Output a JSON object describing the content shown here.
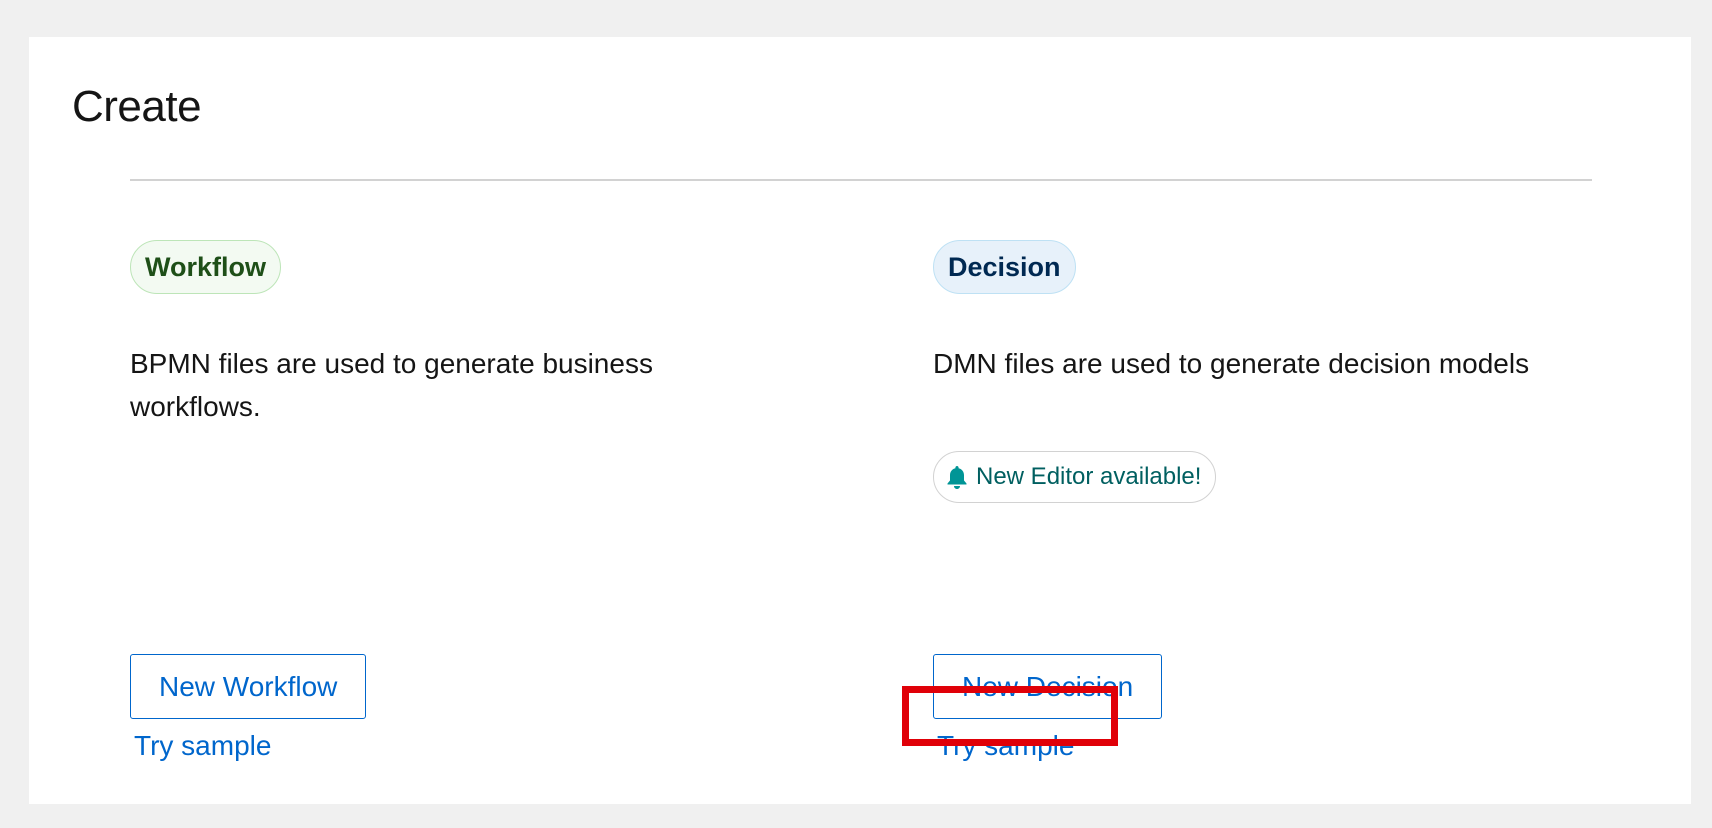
{
  "page": {
    "title": "Create"
  },
  "workflow": {
    "label": "Workflow",
    "description": "BPMN files are used to generate business workflows.",
    "new_button": "New Workflow",
    "sample_link": "Try sample"
  },
  "decision": {
    "label": "Decision",
    "description": "DMN files are used to generate decision models",
    "notification": "New Editor available!",
    "notification_icon": "bell-icon",
    "new_button": "New Decision",
    "sample_link": "Try sample"
  },
  "colors": {
    "link": "#0066cc",
    "workflow_label_bg": "#f3faf2",
    "decision_label_bg": "#e7f1fa",
    "notification_text": "#005f60",
    "highlight": "#e00008"
  }
}
